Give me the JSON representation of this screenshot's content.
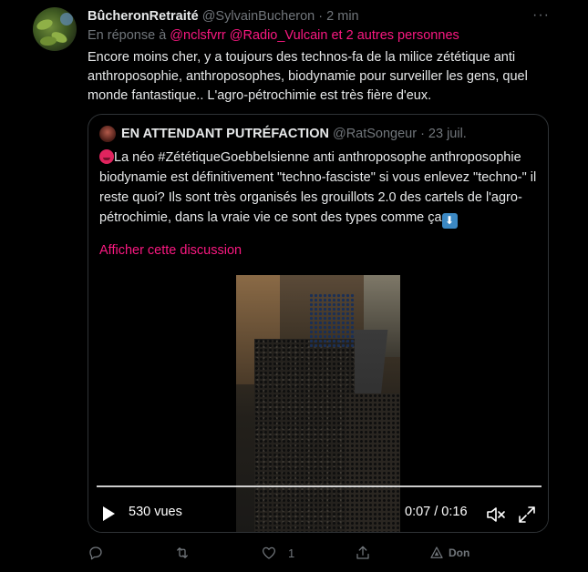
{
  "tweet": {
    "author_name": "BûcheronRetraité",
    "author_handle": "@SylvainBucheron",
    "separator": "·",
    "time": "2 min",
    "more_label": "···",
    "reply_prefix": "En réponse à ",
    "reply_mentions": "@nclsfvrr @Radio_Vulcain",
    "reply_others": " et 2 autres personnes",
    "text": "Encore moins cher, y a toujours des technos-fa de la milice zététique anti anthroposophie, anthroposophes, biodynamie pour surveiller les gens, quel monde fantastique.. L'agro-pétrochimie est très fière d'eux."
  },
  "quote": {
    "author_name": "EN ATTENDANT PUTRÉFACTION",
    "author_handle": "@RatSongeur",
    "separator": "·",
    "time": "23 juil.",
    "text": "La néo #ZététiqueGoebbelsienne anti anthroposophe anthroposophie biodynamie est définitivement \"techno-fasciste\" si vous enlevez \"techno-\" il reste quoi? Ils sont très organisés les grouillots 2.0 des cartels de l'agro-pétrochimie, dans la vraie vie ce sont des types comme ça",
    "show_thread": "Afficher cette discussion",
    "video": {
      "views": "530 vues",
      "time": "0:07 / 0:16",
      "progress": 1.0
    }
  },
  "actions": {
    "reply_count": "",
    "retweet_count": "",
    "like_count": "1",
    "share_label": "Don"
  },
  "colors": {
    "background": "#000000",
    "accent": "#f91880",
    "muted": "#71767b",
    "text": "#e7e9ea",
    "border": "#2f3336"
  }
}
